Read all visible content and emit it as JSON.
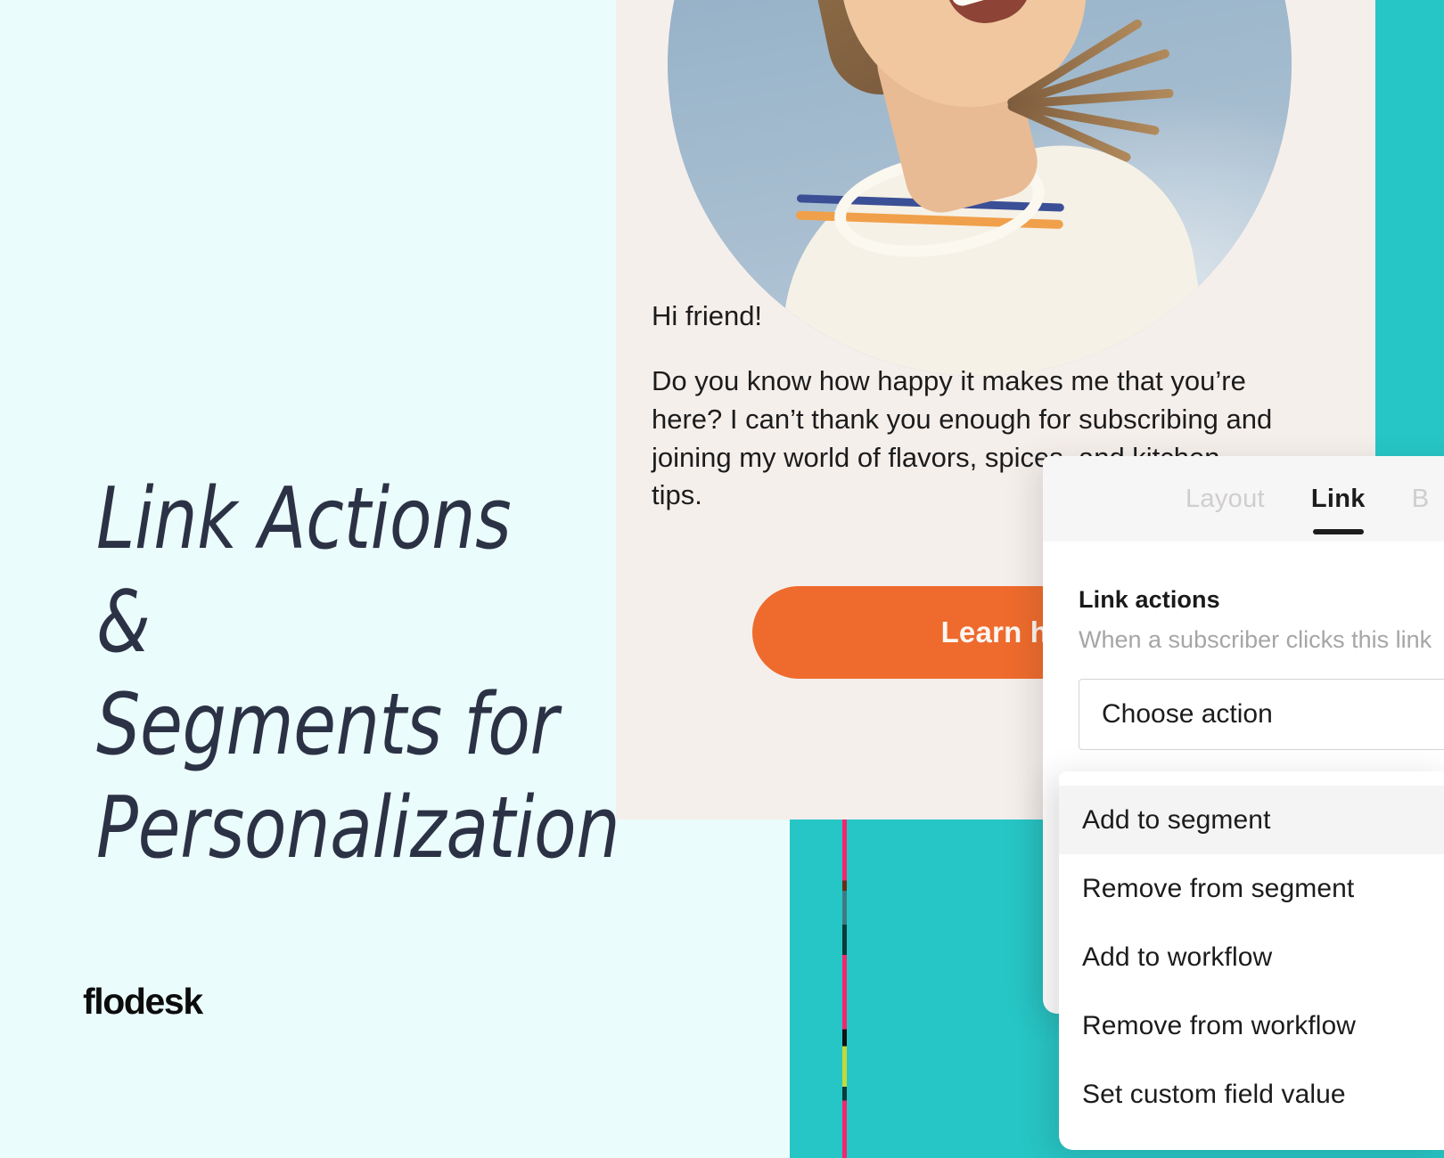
{
  "page": {
    "background_color": "#EAFCFB",
    "accent_teal": "#27C6C6",
    "accent_orange": "#EE6B2D",
    "headline_color": "#2C3245",
    "email_panel_color": "#F5EFEC"
  },
  "hero": {
    "title": "Link Actions &\nSegments for\nPersonalization",
    "brand": "flodesk"
  },
  "email_preview": {
    "photo_alt": "smiling-woman-in-cap-against-sky",
    "greeting": "Hi friend!",
    "paragraph": "Do you know how happy it makes me that you’re here? I can’t thank you enough for subscribing and joining my world of flavors, spices, and kitchen tips.",
    "cta_label": "Learn how"
  },
  "link_panel": {
    "tabs": [
      {
        "label": "Layout",
        "active": false
      },
      {
        "label": "Link",
        "active": true
      },
      {
        "label": "B",
        "active": false
      }
    ],
    "section_title": "Link actions",
    "section_description": "When a subscriber clicks this link",
    "select_value": "Choose action",
    "dropdown_options": [
      {
        "label": "Add to segment",
        "highlighted": true
      },
      {
        "label": "Remove from segment",
        "highlighted": false
      },
      {
        "label": "Add to workflow",
        "highlighted": false
      },
      {
        "label": "Remove from workflow",
        "highlighted": false
      },
      {
        "label": "Set custom field value",
        "highlighted": false
      }
    ]
  }
}
